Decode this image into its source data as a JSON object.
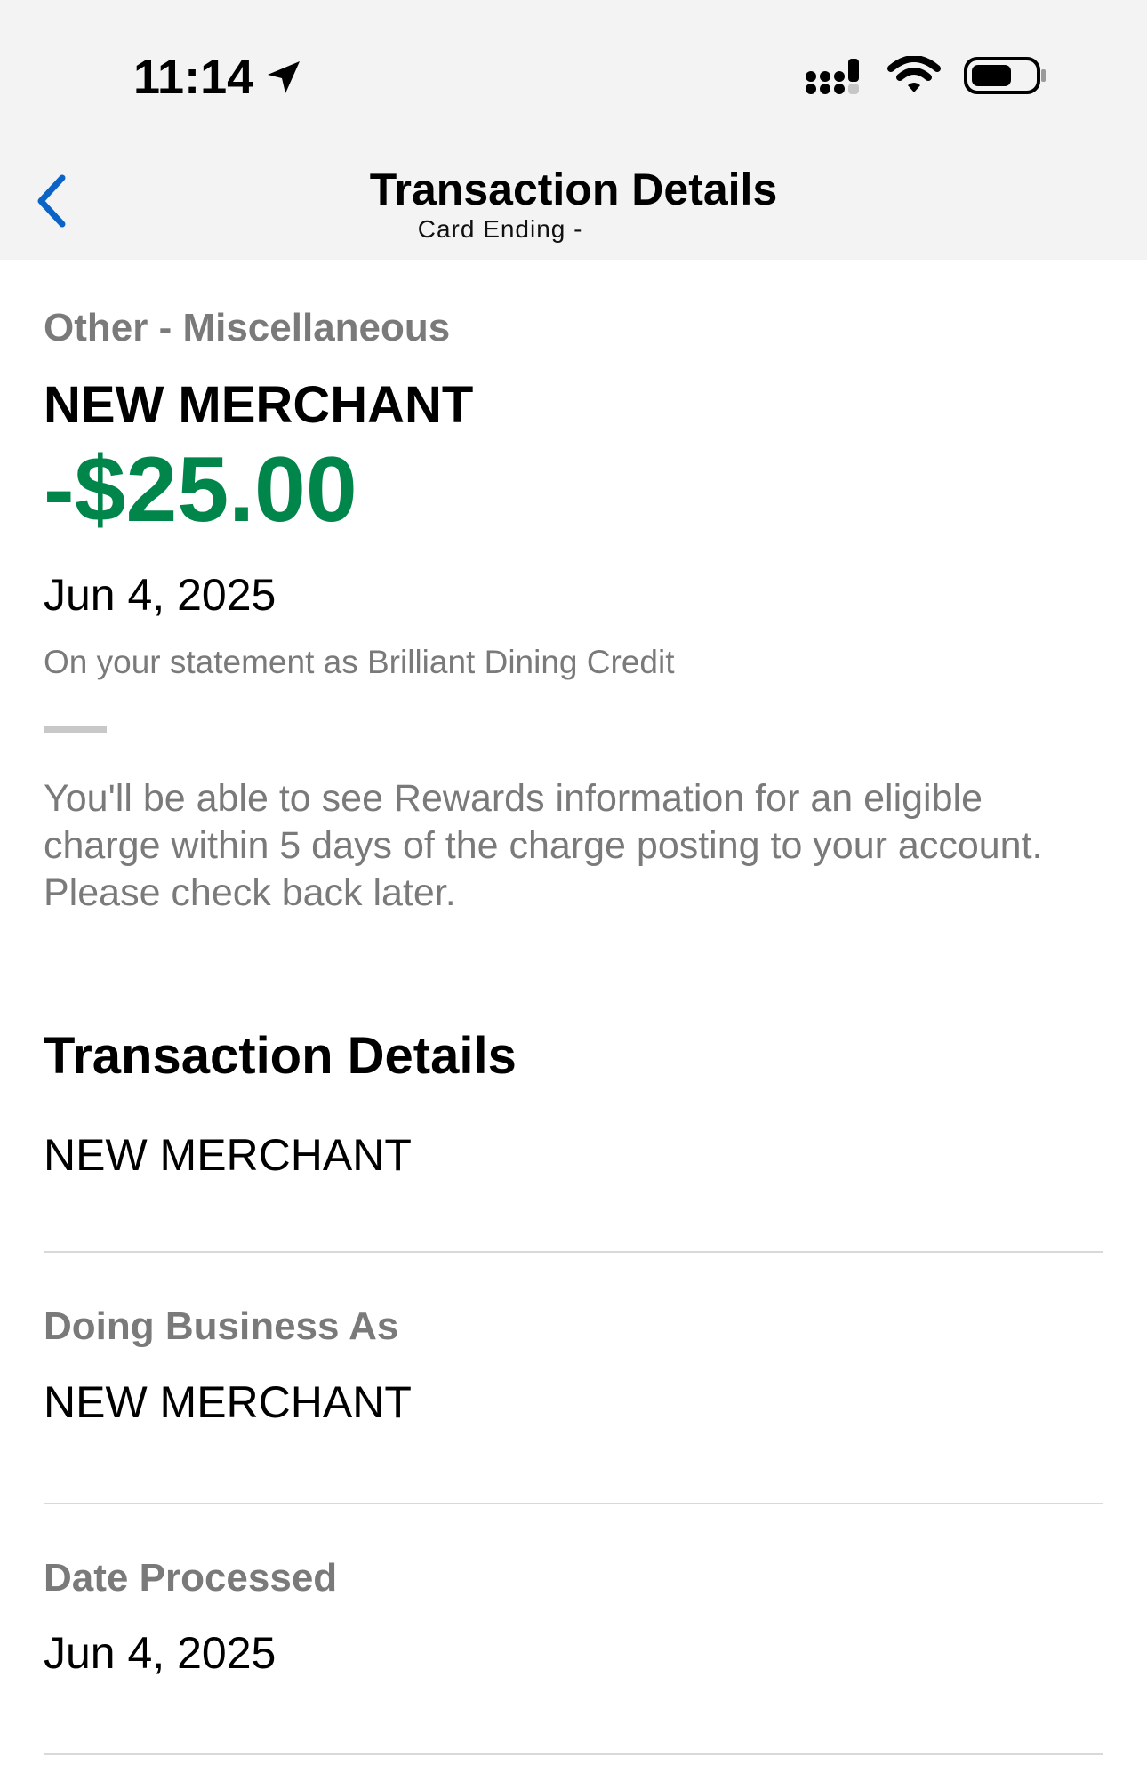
{
  "status_bar": {
    "time": "11:14",
    "icons": [
      "location-arrow-icon",
      "cellular-signal-icon",
      "wifi-icon",
      "battery-icon"
    ]
  },
  "nav": {
    "back_icon": "chevron-left-icon",
    "title": "Transaction Details",
    "subtitle": "Card Ending - "
  },
  "transaction": {
    "category": "Other - Miscellaneous",
    "merchant": "NEW MERCHANT",
    "amount": "-$25.00",
    "date": "Jun 4, 2025",
    "statement_text": "On your statement as Brilliant Dining Credit",
    "rewards_notice": "You'll be able to see Rewards information for an eligible charge within 5 days of the charge posting to your account. Please check back later."
  },
  "details": {
    "section_title": "Transaction Details",
    "merchant_name": "NEW MERCHANT",
    "dba_label": "Doing Business As",
    "dba_value": "NEW MERCHANT",
    "processed_label": "Date Processed",
    "processed_value": "Jun 4, 2025"
  },
  "colors": {
    "amount": "#00854a",
    "accent": "#0a64c8",
    "muted_text": "#7a7a7a",
    "topbar_bg": "#f3f3f3"
  }
}
